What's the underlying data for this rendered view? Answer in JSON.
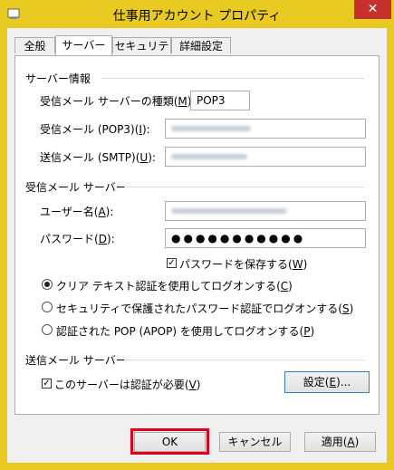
{
  "window": {
    "title": "仕事用アカウント プロパティ",
    "close_label": "✕"
  },
  "tabs": [
    {
      "label": "全般"
    },
    {
      "label": "サーバー",
      "active": true
    },
    {
      "label": "セキュリティ"
    },
    {
      "label": "詳細設定"
    }
  ],
  "server_info": {
    "group_label": "サーバー情報",
    "server_type_label": "受信メール サーバーの種類(",
    "server_type_key": "M",
    "server_type_value": "POP3",
    "incoming_label": "受信メール (POP3)(",
    "incoming_key": "I",
    "outgoing_label": "送信メール (SMTP)(",
    "outgoing_key": "U",
    "label_suffix": "):"
  },
  "incoming_server": {
    "group_label": "受信メール サーバー",
    "username_label": "ユーザー名(",
    "username_key": "A",
    "password_label": "パスワード(",
    "password_key": "D",
    "label_suffix": "):",
    "password_value": "●●●●●●●●●●●",
    "save_password_label": "パスワードを保存する(",
    "save_password_key": "W",
    "save_password_checked": true,
    "close_paren": ")"
  },
  "auth_options": [
    {
      "label": "クリア テキスト認証を使用してログオンする(",
      "key": "C",
      "selected": true
    },
    {
      "label": "セキュリティで保護されたパスワード認証でログオンする(",
      "key": "S",
      "selected": false
    },
    {
      "label": "認証された POP (APOP) を使用してログオンする(",
      "key": "P",
      "selected": false
    }
  ],
  "outgoing_server": {
    "group_label": "送信メール サーバー",
    "auth_required_label": "このサーバーは認証が必要(",
    "auth_required_key": "V",
    "auth_required_checked": true,
    "settings_label": "設定(",
    "settings_key": "E",
    "settings_suffix": ")..."
  },
  "buttons": {
    "ok": "OK",
    "cancel": "キャンセル",
    "apply_label": "適用(",
    "apply_key": "A",
    "close_paren": ")"
  },
  "colors": {
    "title_bar": "#e9ca22",
    "close_button": "#c7302b",
    "ok_highlight": "#e0001b"
  }
}
